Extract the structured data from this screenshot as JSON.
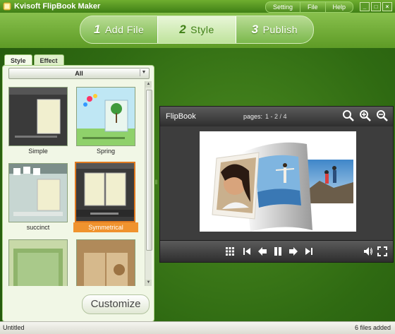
{
  "window": {
    "title": "Kvisoft FlipBook Maker",
    "menu": [
      "Setting",
      "File",
      "Help"
    ],
    "controls": [
      "_",
      "□",
      "×"
    ]
  },
  "steps": [
    {
      "num": "1",
      "label": "Add File",
      "active": false
    },
    {
      "num": "2",
      "label": "Style",
      "active": true
    },
    {
      "num": "3",
      "label": "Publish",
      "active": false
    }
  ],
  "left_panel": {
    "tabs": [
      {
        "label": "Style",
        "active": true
      },
      {
        "label": "Effect",
        "active": false
      }
    ],
    "filter": "All",
    "templates": [
      {
        "label": "Simple",
        "selected": false
      },
      {
        "label": "Spring",
        "selected": false
      },
      {
        "label": "succinct",
        "selected": false
      },
      {
        "label": "Symmetrical",
        "selected": true
      },
      {
        "label": "",
        "selected": false
      },
      {
        "label": "",
        "selected": false
      }
    ],
    "customize_label": "Customize"
  },
  "preview": {
    "title": "FlipBook",
    "pages_label": "pages:",
    "pages_value": "1 - 2 / 4",
    "toolbar_icons": [
      "thumbnails-icon",
      "first-page-icon",
      "prev-page-icon",
      "pause-icon",
      "next-page-icon",
      "last-page-icon",
      "sound-icon",
      "fullscreen-icon"
    ]
  },
  "status": {
    "left": "Untitled",
    "right": "6 files added"
  },
  "colors": {
    "brand_green": "#5e9b26",
    "selected_orange": "#f0932e"
  }
}
